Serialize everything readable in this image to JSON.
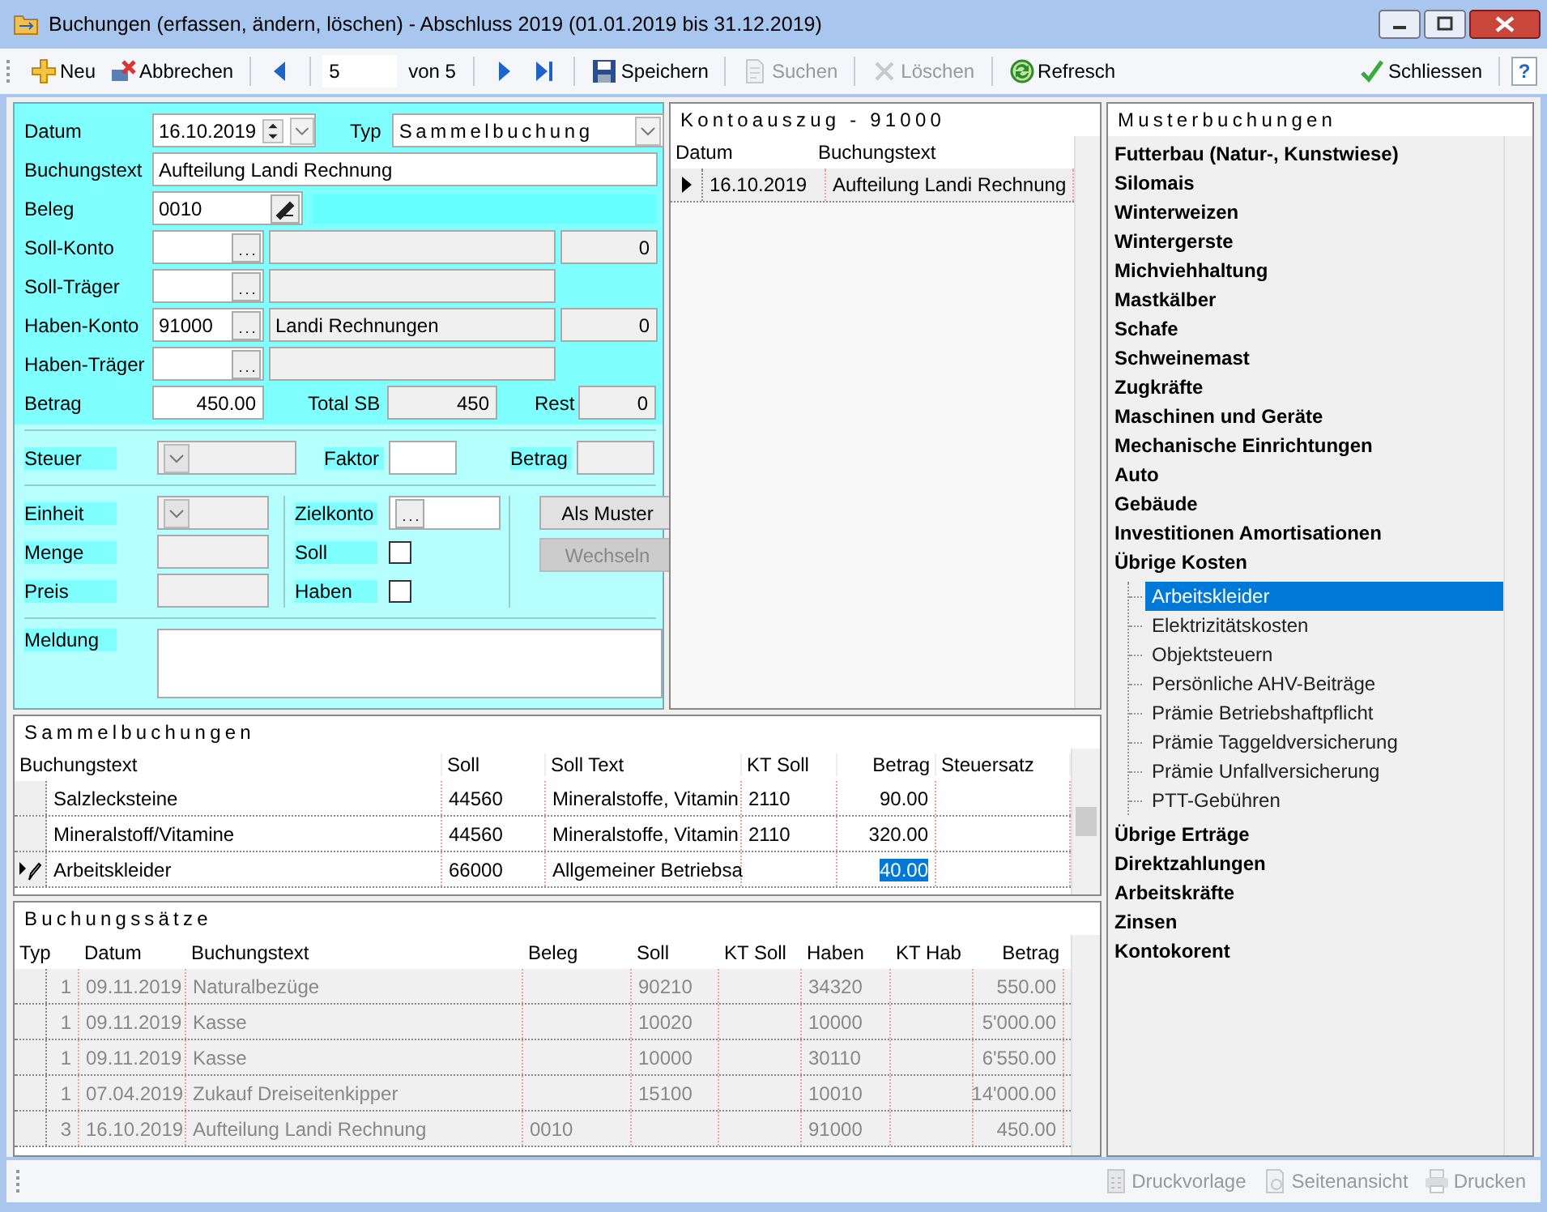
{
  "window": {
    "title": "Buchungen (erfassen, ändern, löschen) - Abschluss 2019 (01.01.2019 bis 31.12.2019)"
  },
  "toolbar": [
    {
      "kind": "add",
      "label": "Neu",
      "disabled": false
    },
    {
      "kind": "cancel",
      "label": "Abbrechen",
      "disabled": false
    },
    {
      "kind": "separator"
    },
    {
      "kind": "prev"
    },
    {
      "kind": "separator"
    },
    {
      "kind": "position",
      "value": "5"
    },
    {
      "kind": "text",
      "label": "von 5"
    },
    {
      "kind": "separator"
    },
    {
      "kind": "next"
    },
    {
      "kind": "last"
    },
    {
      "kind": "separator"
    },
    {
      "kind": "save",
      "label": "Speichern",
      "disabled": false
    },
    {
      "kind": "separator"
    },
    {
      "kind": "search",
      "label": "Suchen",
      "disabled": true
    },
    {
      "kind": "separator"
    },
    {
      "kind": "delete",
      "label": "Löschen",
      "disabled": true
    },
    {
      "kind": "separator"
    },
    {
      "kind": "refresh",
      "label": "Refresch",
      "disabled": false
    },
    {
      "kind": "spacer"
    },
    {
      "kind": "close",
      "label": "Schliessen",
      "disabled": false
    },
    {
      "kind": "separator"
    },
    {
      "kind": "help",
      "label": "?"
    }
  ],
  "form": {
    "datum": {
      "label": "Datum",
      "value": "16.10.2019"
    },
    "typ": {
      "label": "Typ",
      "value": "Sammelbuchung"
    },
    "buchungstext": {
      "label": "Buchungstext",
      "value": "Aufteilung Landi Rechnung"
    },
    "beleg": {
      "label": "Beleg",
      "value": "0010"
    },
    "soll_konto": {
      "label": "Soll-Konto",
      "amount": "0"
    },
    "soll_traeger": {
      "label": "Soll-Träger"
    },
    "haben_konto": {
      "label": "Haben-Konto",
      "value": "91000",
      "name": "Landi Rechnungen",
      "amount": "0"
    },
    "haben_traeger": {
      "label": "Haben-Träger"
    },
    "betrag": {
      "label": "Betrag",
      "value": "450.00"
    },
    "total_sb": {
      "label": "Total SB",
      "value": "450"
    },
    "rest": {
      "label": "Rest",
      "value": "0"
    },
    "steuer": {
      "label": "Steuer",
      "disabled": true
    },
    "faktor": {
      "label": "Faktor",
      "disabled": false
    },
    "steuer_betrag": {
      "label": "Betrag",
      "disabled": true
    },
    "einheit": {
      "label": "Einheit",
      "disabled": true
    },
    "menge": {
      "label": "Menge",
      "disabled": true
    },
    "preis": {
      "label": "Preis",
      "disabled": true
    },
    "zielkonto": {
      "label": "Zielkonto"
    },
    "soll": {
      "label": "Soll",
      "checked": false
    },
    "haben": {
      "label": "Haben",
      "checked": false
    },
    "buttons": [
      {
        "label": "Als Muster",
        "disabled": false
      },
      {
        "label": "Wechseln",
        "disabled": true
      }
    ],
    "meldung": {
      "label": "Meldung"
    }
  },
  "kontoauszug": {
    "title": "Kontoauszug - 91000",
    "columns": [
      "Datum",
      "Buchungstext"
    ],
    "rows": [
      {
        "cells": [
          "16.10.2019",
          "Aufteilung Landi Rechnung"
        ],
        "current": true
      }
    ]
  },
  "sammelbuchungen": {
    "title": "Sammelbuchungen",
    "columns": [
      "Buchungstext",
      "Soll",
      "Soll Text",
      "KT Soll",
      "Betrag",
      "Steuersatz"
    ],
    "rows": [
      {
        "buchungstext": "Salzlecksteine",
        "soll": "44560",
        "soll_text": "Mineralstoffe, Vitamin",
        "kt_soll": "2110",
        "betrag": "90.00",
        "editing": false
      },
      {
        "buchungstext": "Mineralstoff/Vitamine",
        "soll": "44560",
        "soll_text": "Mineralstoffe, Vitamin",
        "kt_soll": "2110",
        "betrag": "320.00",
        "editing": false
      },
      {
        "buchungstext": "Arbeitskleider",
        "soll": "66000",
        "soll_text": "Allgemeiner Betriebsa",
        "betrag": "40.00",
        "editing": true
      }
    ]
  },
  "buchungssaetze": {
    "title": "Buchungssätze",
    "disabled": true,
    "columns": [
      "Typ",
      "Datum",
      "Buchungstext",
      "Beleg",
      "Soll",
      "KT Soll",
      "Haben",
      "KT Hab",
      "Betrag"
    ],
    "rows": [
      {
        "typ": "1",
        "datum": "09.11.2019",
        "buchungstext": "Naturalbezüge",
        "soll": "90210",
        "haben": "34320",
        "betrag": "550.00"
      },
      {
        "typ": "1",
        "datum": "09.11.2019",
        "buchungstext": "Kasse",
        "soll": "10020",
        "haben": "10000",
        "betrag": "5'000.00"
      },
      {
        "typ": "1",
        "datum": "09.11.2019",
        "buchungstext": "Kasse",
        "soll": "10000",
        "haben": "30110",
        "betrag": "6'550.00"
      },
      {
        "typ": "1",
        "datum": "07.04.2019",
        "buchungstext": "Zukauf Dreiseitenkipper",
        "soll": "15100",
        "haben": "10010",
        "betrag": "14'000.00"
      },
      {
        "typ": "3",
        "datum": "16.10.2019",
        "buchungstext": "Aufteilung Landi Rechnung",
        "beleg": "0010",
        "haben": "91000",
        "betrag": "450.00"
      }
    ]
  },
  "musterbuchungen": {
    "title": "Musterbuchungen",
    "items": [
      {
        "label": "Futterbau (Natur-, Kunstwiese)",
        "selected": false
      },
      {
        "label": "Silomais",
        "selected": false
      },
      {
        "label": "Winterweizen",
        "selected": false
      },
      {
        "label": "Wintergerste",
        "selected": false
      },
      {
        "label": "Michviehhaltung",
        "selected": false
      },
      {
        "label": "Mastkälber",
        "selected": false
      },
      {
        "label": "Schafe",
        "selected": false
      },
      {
        "label": "Schweinemast",
        "selected": false
      },
      {
        "label": "Zugkräfte",
        "selected": false
      },
      {
        "label": "Maschinen und Geräte",
        "selected": false
      },
      {
        "label": "Mechanische Einrichtungen",
        "selected": false
      },
      {
        "label": "Auto",
        "selected": false
      },
      {
        "label": "Gebäude",
        "selected": false
      },
      {
        "label": "Investitionen Amortisationen",
        "selected": false
      },
      {
        "label": "Übrige Kosten",
        "selected": false,
        "children": [
          {
            "label": "Arbeitskleider",
            "selected": true
          },
          {
            "label": "Elektrizitätskosten",
            "selected": false
          },
          {
            "label": "Objektsteuern",
            "selected": false
          },
          {
            "label": "Persönliche AHV-Beiträge",
            "selected": false
          },
          {
            "label": "Prämie Betriebshaftpflicht",
            "selected": false
          },
          {
            "label": "Prämie Taggeldversicherung",
            "selected": false
          },
          {
            "label": "Prämie Unfallversicherung",
            "selected": false
          },
          {
            "label": "PTT-Gebühren",
            "selected": false
          }
        ]
      },
      {
        "label": "Übrige Erträge",
        "selected": false
      },
      {
        "label": "Direktzahlungen",
        "selected": false
      },
      {
        "label": "Arbeitskräfte",
        "selected": false
      },
      {
        "label": "Zinsen",
        "selected": false
      },
      {
        "label": "Kontokorent",
        "selected": false
      }
    ]
  },
  "footer": [
    {
      "kind": "template",
      "label": "Druckvorlage",
      "disabled": true
    },
    {
      "kind": "preview",
      "label": "Seitenansicht",
      "disabled": true
    },
    {
      "kind": "print",
      "label": "Drucken",
      "disabled": true
    }
  ]
}
